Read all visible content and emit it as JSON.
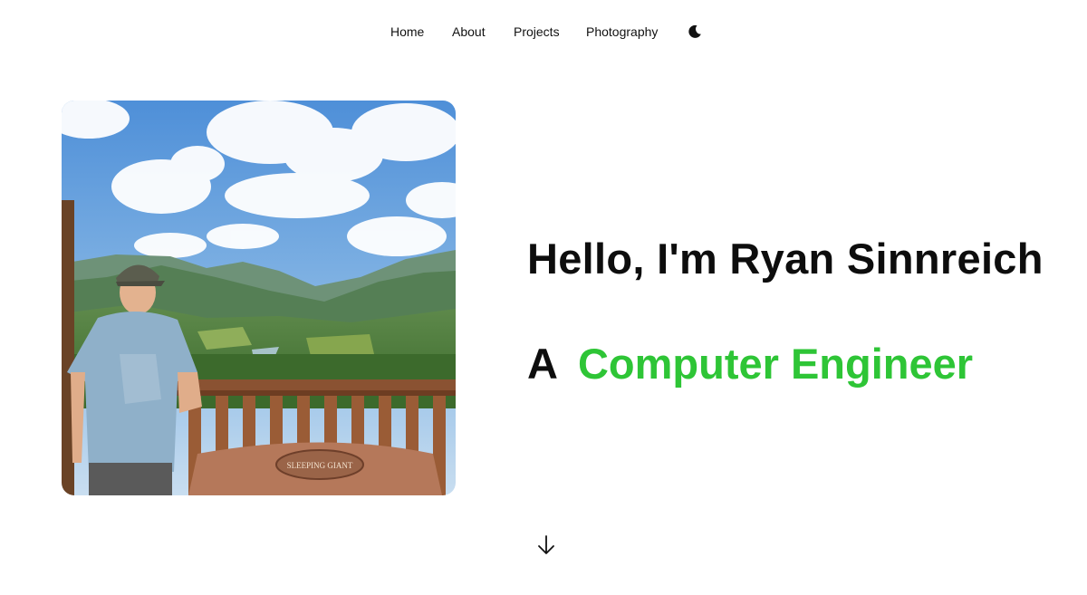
{
  "nav": {
    "items": [
      {
        "label": "Home"
      },
      {
        "label": "About"
      },
      {
        "label": "Projects"
      },
      {
        "label": "Photography"
      }
    ],
    "theme_toggle_icon": "moon-icon"
  },
  "hero": {
    "greeting": "Hello, I'm Ryan Sinnreich",
    "role_prefix": "A",
    "role": "Computer Engineer",
    "accent_color": "#2ec536",
    "photo_alt": "Ryan Sinnreich at a mountain overlook",
    "photo_sign_text": "SLEEPING GIANT",
    "scroll_icon": "arrow-down-icon"
  }
}
